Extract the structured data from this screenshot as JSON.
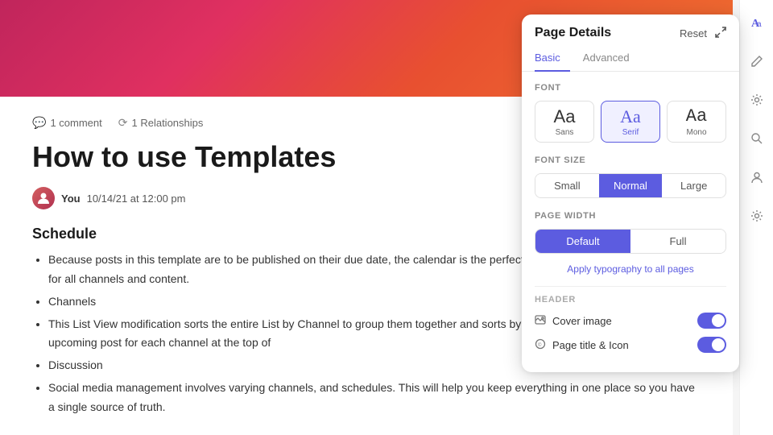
{
  "panel": {
    "title": "Page Details",
    "reset_label": "Reset",
    "expand_icon": "⤢",
    "tabs": [
      {
        "id": "basic",
        "label": "Basic",
        "active": true
      },
      {
        "id": "advanced",
        "label": "Advanced",
        "active": false
      }
    ],
    "font_section_label": "Font",
    "font_options": [
      {
        "id": "sans",
        "sample": "Aa",
        "name": "Sans",
        "selected": false,
        "style": "sans"
      },
      {
        "id": "serif",
        "sample": "Aa",
        "name": "Serif",
        "selected": true,
        "style": "serif"
      },
      {
        "id": "mono",
        "sample": "Aa",
        "name": "Mono",
        "selected": false,
        "style": "mono"
      }
    ],
    "font_size_section_label": "Font Size",
    "font_size_options": [
      {
        "id": "small",
        "label": "Small",
        "selected": false
      },
      {
        "id": "normal",
        "label": "Normal",
        "selected": true
      },
      {
        "id": "large",
        "label": "Large",
        "selected": false
      }
    ],
    "page_width_section_label": "Page Width",
    "page_width_options": [
      {
        "id": "default",
        "label": "Default",
        "selected": true
      },
      {
        "id": "full",
        "label": "Full",
        "selected": false
      }
    ],
    "apply_typography_label": "Apply typography to all pages",
    "header_section_label": "Header",
    "header_toggles": [
      {
        "id": "cover_image",
        "label": "Cover image",
        "icon": "🖼",
        "enabled": true
      },
      {
        "id": "page_title",
        "label": "Page title & Icon",
        "icon": "©",
        "enabled": true
      }
    ]
  },
  "document": {
    "comment_count": "1 comment",
    "relationship_count": "1 Relationships",
    "title": "How to use Templates",
    "author_name": "You",
    "author_date": "10/14/21 at 12:00 pm",
    "schedule_heading": "Schedule",
    "bullet_items": [
      "Because posts in this template are to be published on their due date, the calendar is the perfect place to manage publication dates for all channels and content.",
      "Channels",
      "This List View modification sorts the entire List by Channel to group them together and sorts by due date so you can see the upcoming post for each channel at the top of",
      "Discussion",
      "Social media management involves varying channels, and schedules. This will help you keep everything in one place so you have a single source of truth."
    ]
  },
  "icons": {
    "comment_icon": "💬",
    "relationship_icon": "⟳",
    "aa_icon": "Aa",
    "pencil_icon": "✏",
    "gear_icon": "⚙",
    "search_icon": "🔍",
    "person_icon": "👤"
  }
}
